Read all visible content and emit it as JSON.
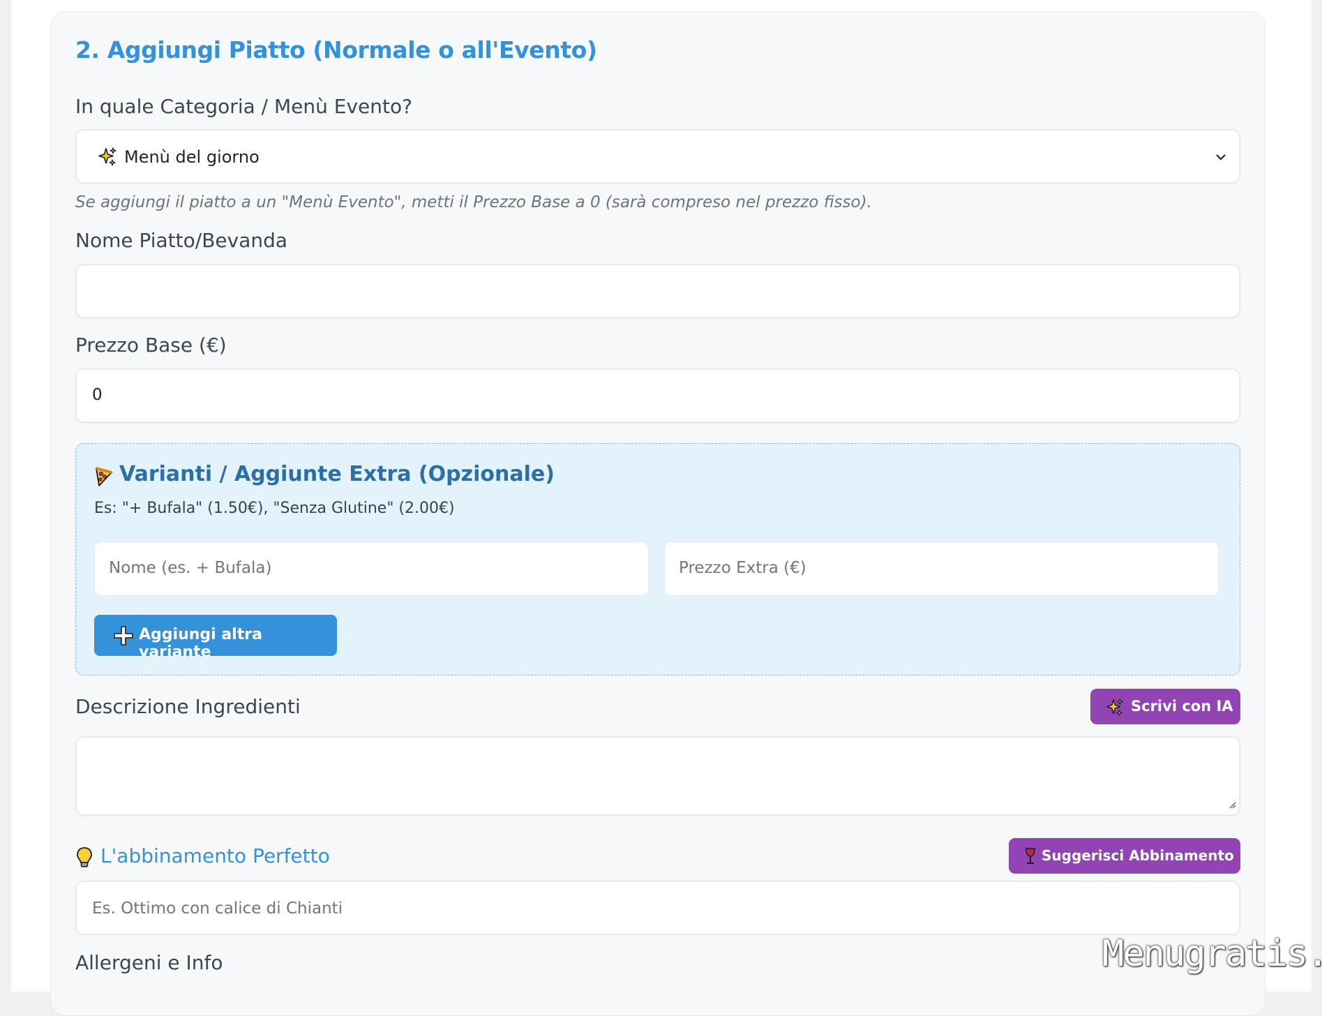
{
  "section": {
    "title": "2. Aggiungi Piatto (Normale o all'Evento)"
  },
  "category": {
    "label": "In quale Categoria / Menù Evento?",
    "selected": "Menù del giorno",
    "selected_icon": "sparkles-icon",
    "hint": "Se aggiungi il piatto a un \"Menù Evento\", metti il Prezzo Base a 0 (sarà compreso nel prezzo fisso)."
  },
  "name_field": {
    "label": "Nome Piatto/Bevanda",
    "value": ""
  },
  "price_field": {
    "label": "Prezzo Base (€)",
    "value": "0"
  },
  "variants": {
    "title": "Varianti / Aggiunte Extra (Opzionale)",
    "icon": "pizza-icon",
    "subtitle": "Es: \"+ Bufala\" (1.50€), \"Senza Glutine\" (2.00€)",
    "name_placeholder": "Nome (es. + Bufala)",
    "price_placeholder": "Prezzo Extra (€)",
    "add_button": "Aggiungi altra variante"
  },
  "description": {
    "label": "Descrizione Ingredienti",
    "ai_button": "Scrivi con IA",
    "value": ""
  },
  "pairing": {
    "label": "L'abbinamento Perfetto",
    "icon": "lightbulb-icon",
    "button": "Suggerisci Abbinamento",
    "button_icon": "wine-glass-icon",
    "placeholder": "Es. Ottimo con calice di Chianti"
  },
  "allergens": {
    "label": "Allergeni e Info"
  },
  "watermark": "Menugratis.it",
  "colors": {
    "accent_blue": "#3392dc",
    "variants_bg": "#e4f2fc",
    "purple_button": "#9244b4"
  }
}
